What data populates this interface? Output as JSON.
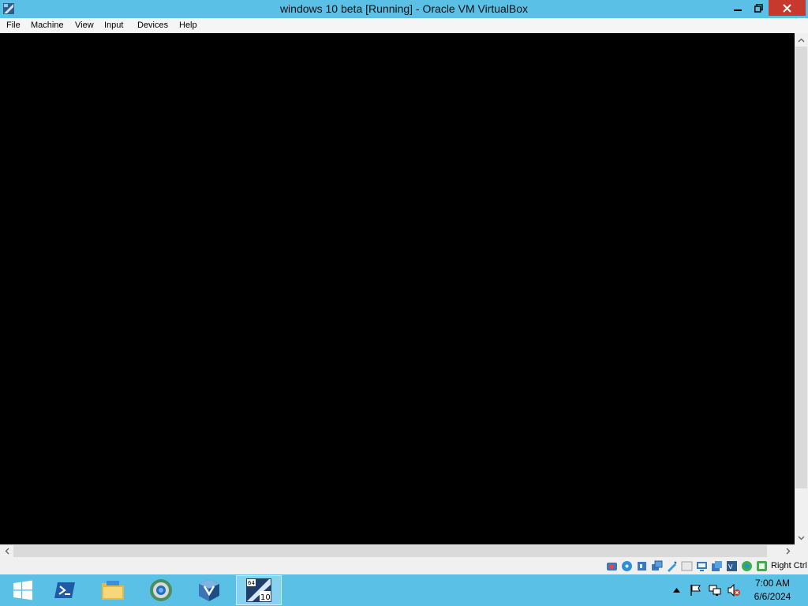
{
  "window": {
    "title": "windows 10 beta [Running] - Oracle VM VirtualBox",
    "buttons": [
      "minimize",
      "restore",
      "close"
    ]
  },
  "menubar": {
    "items": [
      {
        "label": "File"
      },
      {
        "label": "Machine"
      },
      {
        "label": "View"
      },
      {
        "label": "Input"
      },
      {
        "label": "Devices"
      },
      {
        "label": "Help"
      }
    ]
  },
  "statusbar": {
    "icons": [
      "hard-disk-icon",
      "optical-drive-icon",
      "audio-icon",
      "network-icon",
      "usb-icon",
      "shared-folders-icon",
      "display-icon",
      "video-capture-icon",
      "virtualization-icon",
      "mouse-integration-icon",
      "cpu-icon"
    ],
    "host_key": "Right Ctrl"
  },
  "taskbar": {
    "apps": [
      {
        "name": "start-button",
        "icon": "windows-logo-icon"
      },
      {
        "name": "taskbar-powershell",
        "icon": "powershell-icon"
      },
      {
        "name": "taskbar-file-explorer",
        "icon": "folder-icon"
      },
      {
        "name": "taskbar-browser",
        "icon": "browser-icon"
      },
      {
        "name": "taskbar-virtualbox-manager",
        "icon": "virtualbox-icon"
      },
      {
        "name": "taskbar-vm-window",
        "icon": "vm-windows10-icon",
        "active": true
      }
    ],
    "tray": {
      "icons": [
        "show-hidden-icons-icon",
        "action-center-flag-icon",
        "network-icon",
        "volume-muted-icon"
      ],
      "time": "7:00 AM",
      "date": "6/6/2024"
    }
  },
  "colors": {
    "accent": "#5bc0e6",
    "close_button": "#c7392d",
    "vm_screen": "#000000"
  }
}
